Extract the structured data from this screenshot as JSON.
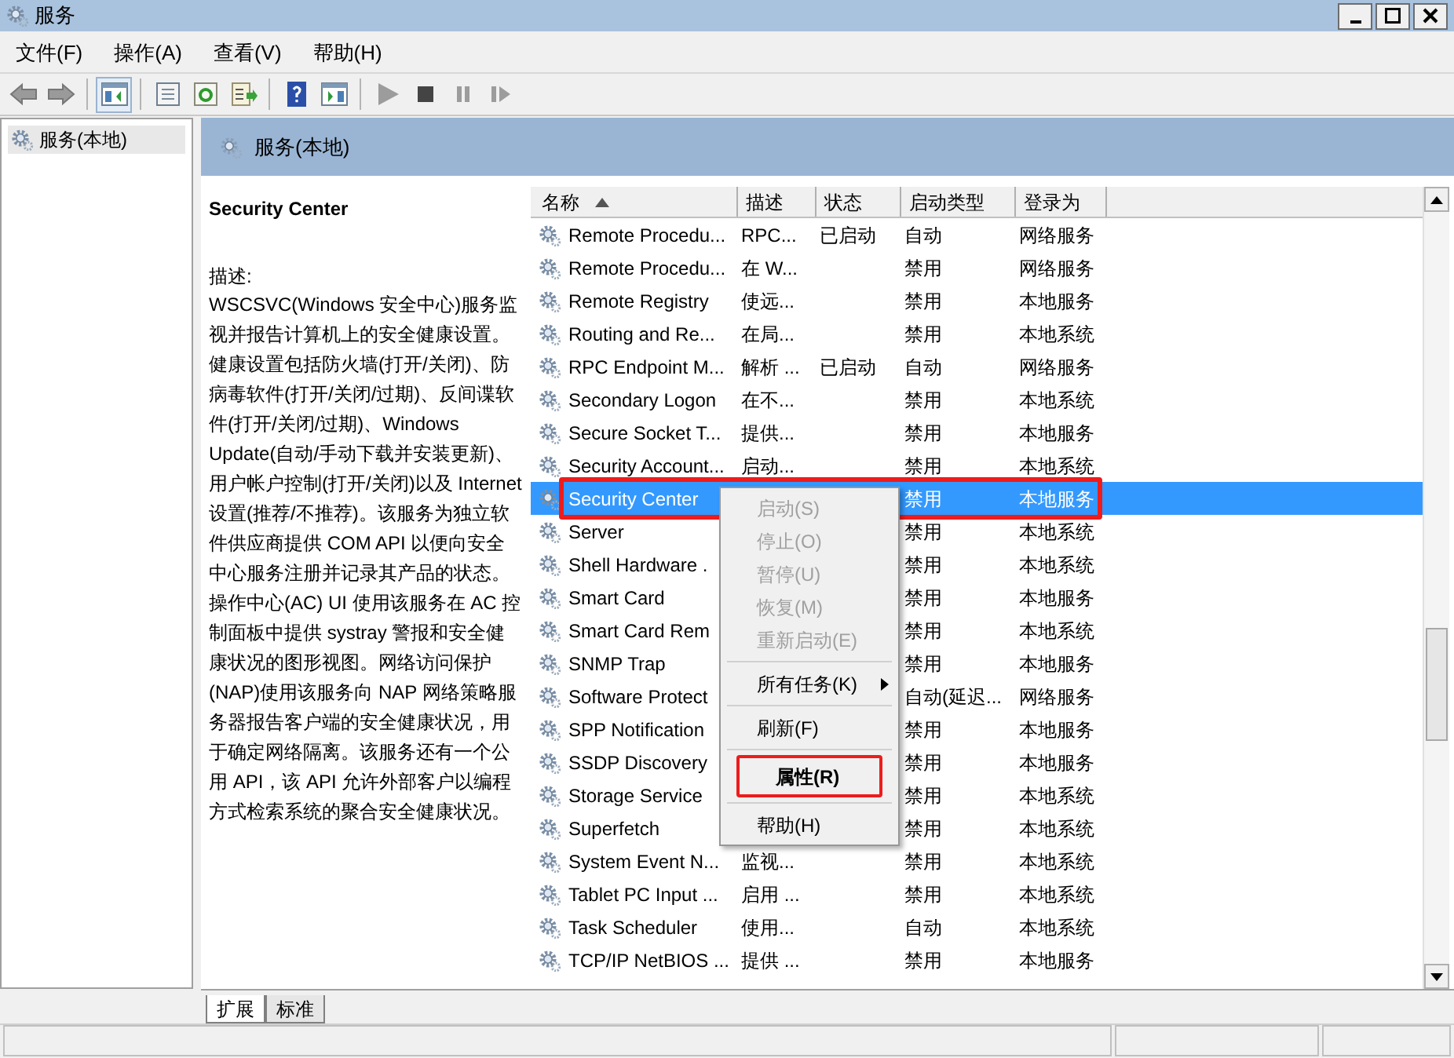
{
  "window": {
    "title": "服务"
  },
  "menu": [
    "文件(F)",
    "操作(A)",
    "查看(V)",
    "帮助(H)"
  ],
  "toolbar": [
    {
      "kind": "back"
    },
    {
      "kind": "forward"
    },
    {
      "kind": "sep"
    },
    {
      "kind": "tree",
      "selected": true
    },
    {
      "kind": "sep"
    },
    {
      "kind": "props"
    },
    {
      "kind": "refresh"
    },
    {
      "kind": "export"
    },
    {
      "kind": "sep"
    },
    {
      "kind": "help"
    },
    {
      "kind": "pane"
    },
    {
      "kind": "sep"
    },
    {
      "kind": "play"
    },
    {
      "kind": "stop"
    },
    {
      "kind": "pause"
    },
    {
      "kind": "restart"
    }
  ],
  "tree": [
    {
      "label": "服务(本地)",
      "selected": true
    }
  ],
  "panel_title": "服务(本地)",
  "detail": {
    "name": "Security Center",
    "label": "描述:",
    "text": "WSCSVC(Windows 安全中心)服务监视并报告计算机上的安全健康设置。健康设置包括防火墙(打开/关闭)、防病毒软件(打开/关闭/过期)、反间谍软件(打开/关闭/过期)、Windows Update(自动/手动下载并安装更新)、用户帐户控制(打开/关闭)以及 Internet 设置(推荐/不推荐)。该服务为独立软件供应商提供 COM API 以便向安全中心服务注册并记录其产品的状态。操作中心(AC) UI 使用该服务在 AC 控制面板中提供 systray 警报和安全健康状况的图形视图。网络访问保护(NAP)使用该服务向 NAP 网络策略服务器报告客户端的安全健康状况，用于确定网络隔离。该服务还有一个公用 API，该 API 允许外部客户以编程方式检索系统的聚合安全健康状况。"
  },
  "table": {
    "columns": [
      "名称",
      "描述",
      "状态",
      "启动类型",
      "登录为"
    ],
    "rows": [
      {
        "name": "Remote Procedu...",
        "desc": "RPC...",
        "status": "已启动",
        "startup": "自动",
        "logon": "网络服务",
        "selected": false,
        "highlighted": false
      },
      {
        "name": "Remote Procedu...",
        "desc": "在 W...",
        "startup": "禁用",
        "logon": "网络服务",
        "selected": false,
        "highlighted": false
      },
      {
        "name": "Remote Registry",
        "desc": "使远...",
        "startup": "禁用",
        "logon": "本地服务",
        "selected": false,
        "highlighted": false
      },
      {
        "name": "Routing and Re...",
        "desc": "在局...",
        "startup": "禁用",
        "logon": "本地系统",
        "selected": false,
        "highlighted": false
      },
      {
        "name": "RPC Endpoint M...",
        "desc": "解析 ...",
        "status": "已启动",
        "startup": "自动",
        "logon": "网络服务",
        "selected": false,
        "highlighted": false
      },
      {
        "name": "Secondary Logon",
        "desc": "在不...",
        "startup": "禁用",
        "logon": "本地系统",
        "selected": false,
        "highlighted": false
      },
      {
        "name": "Secure Socket T...",
        "desc": "提供...",
        "startup": "禁用",
        "logon": "本地服务",
        "selected": false,
        "highlighted": false
      },
      {
        "name": "Security Account...",
        "desc": "启动...",
        "startup": "禁用",
        "logon": "本地系统",
        "selected": false,
        "highlighted": false
      },
      {
        "name": "Security Center",
        "startup": "禁用",
        "logon": "本地服务",
        "selected": true,
        "highlighted": true
      },
      {
        "name": "Server",
        "startup": "禁用",
        "logon": "本地系统",
        "selected": false,
        "highlighted": false
      },
      {
        "name": "Shell Hardware .",
        "startup": "禁用",
        "logon": "本地系统",
        "selected": false,
        "highlighted": false
      },
      {
        "name": "Smart Card",
        "startup": "禁用",
        "logon": "本地服务",
        "selected": false,
        "highlighted": false
      },
      {
        "name": "Smart Card Rem",
        "startup": "禁用",
        "logon": "本地系统",
        "selected": false,
        "highlighted": false
      },
      {
        "name": "SNMP Trap",
        "startup": "禁用",
        "logon": "本地服务",
        "selected": false,
        "highlighted": false
      },
      {
        "name": "Software Protect",
        "startup": "自动(延迟...",
        "logon": "网络服务",
        "selected": false,
        "highlighted": false
      },
      {
        "name": "SPP Notification",
        "startup": "禁用",
        "logon": "本地服务",
        "selected": false,
        "highlighted": false
      },
      {
        "name": "SSDP Discovery",
        "startup": "禁用",
        "logon": "本地服务",
        "selected": false,
        "highlighted": false
      },
      {
        "name": "Storage Service",
        "startup": "禁用",
        "logon": "本地系统",
        "selected": false,
        "highlighted": false
      },
      {
        "name": "Superfetch",
        "startup": "禁用",
        "logon": "本地系统",
        "selected": false,
        "highlighted": false
      },
      {
        "name": "System Event N...",
        "desc": "监视...",
        "startup": "禁用",
        "logon": "本地系统",
        "selected": false,
        "highlighted": false
      },
      {
        "name": "Tablet PC Input ...",
        "desc": "启用 ...",
        "startup": "禁用",
        "logon": "本地系统",
        "selected": false,
        "highlighted": false
      },
      {
        "name": "Task Scheduler",
        "desc": "使用...",
        "startup": "自动",
        "logon": "本地系统",
        "selected": false,
        "highlighted": false
      },
      {
        "name": "TCP/IP NetBIOS ...",
        "desc": "提供 ...",
        "startup": "禁用",
        "logon": "本地服务",
        "selected": false,
        "highlighted": false
      }
    ]
  },
  "context_menu": [
    {
      "kind": "item",
      "label": "启动(S)",
      "disabled": true,
      "bold": false,
      "submenu": false,
      "highlighted": false
    },
    {
      "kind": "item",
      "label": "停止(O)",
      "disabled": true,
      "bold": false,
      "submenu": false,
      "highlighted": false
    },
    {
      "kind": "item",
      "label": "暂停(U)",
      "disabled": true,
      "bold": false,
      "submenu": false,
      "highlighted": false
    },
    {
      "kind": "item",
      "label": "恢复(M)",
      "disabled": true,
      "bold": false,
      "submenu": false,
      "highlighted": false
    },
    {
      "kind": "item",
      "label": "重新启动(E)",
      "disabled": true,
      "bold": false,
      "submenu": false,
      "highlighted": false
    },
    {
      "kind": "separator"
    },
    {
      "kind": "item",
      "label": "所有任务(K)",
      "disabled": false,
      "bold": false,
      "submenu": true,
      "highlighted": false
    },
    {
      "kind": "separator"
    },
    {
      "kind": "item",
      "label": "刷新(F)",
      "disabled": false,
      "bold": false,
      "submenu": false,
      "highlighted": false
    },
    {
      "kind": "separator"
    },
    {
      "kind": "item",
      "label": "属性(R)",
      "disabled": false,
      "bold": true,
      "submenu": false,
      "highlighted": true
    },
    {
      "kind": "separator"
    },
    {
      "kind": "item",
      "label": "帮助(H)",
      "disabled": false,
      "bold": false,
      "submenu": false,
      "highlighted": false
    }
  ],
  "bottom_tabs": [
    {
      "label": "扩展",
      "selected": true
    },
    {
      "label": "标准",
      "selected": false
    }
  ]
}
